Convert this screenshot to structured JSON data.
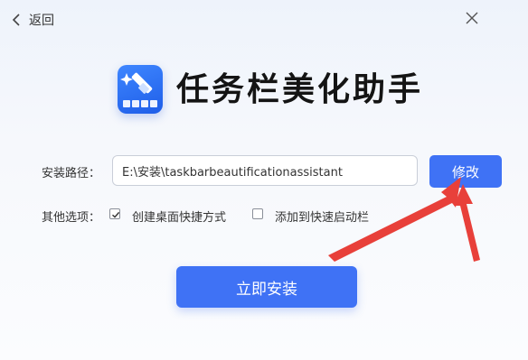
{
  "header": {
    "back_label": "返回"
  },
  "app": {
    "title": "任务栏美化助手"
  },
  "install_path": {
    "label": "安装路径：",
    "value": "E:\\安装\\taskbarbeautificationassistant",
    "modify_label": "修改"
  },
  "options": {
    "label": "其他选项：",
    "items": [
      {
        "label": "创建桌面快捷方式",
        "checked": true
      },
      {
        "label": "添加到快速启动栏",
        "checked": false
      }
    ]
  },
  "actions": {
    "install_label": "立即安装"
  },
  "colors": {
    "accent": "#3f72f5",
    "annotation": "#e8403a"
  }
}
